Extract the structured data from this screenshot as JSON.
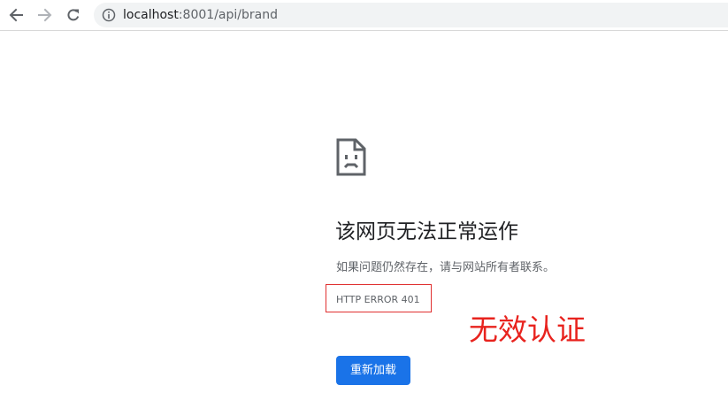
{
  "browser": {
    "back_icon": "arrow-left-icon",
    "forward_icon": "arrow-right-icon",
    "reload_icon": "reload-icon",
    "info_icon": "info-circle-icon",
    "url_host": "localhost",
    "url_path": ":8001/api/brand"
  },
  "error_page": {
    "icon": "sad-file-icon",
    "title": "该网页无法正常运作",
    "description": "如果问题仍然存在，请与网站所有者联系。",
    "error_code": "HTTP ERROR 401",
    "reload_label": "重新加载"
  },
  "annotation": {
    "text": "无效认证",
    "color": "#e8231e",
    "box_color": "#e03030"
  },
  "colors": {
    "primary_button": "#1a73e8",
    "omnibox_bg": "#f1f3f4"
  }
}
